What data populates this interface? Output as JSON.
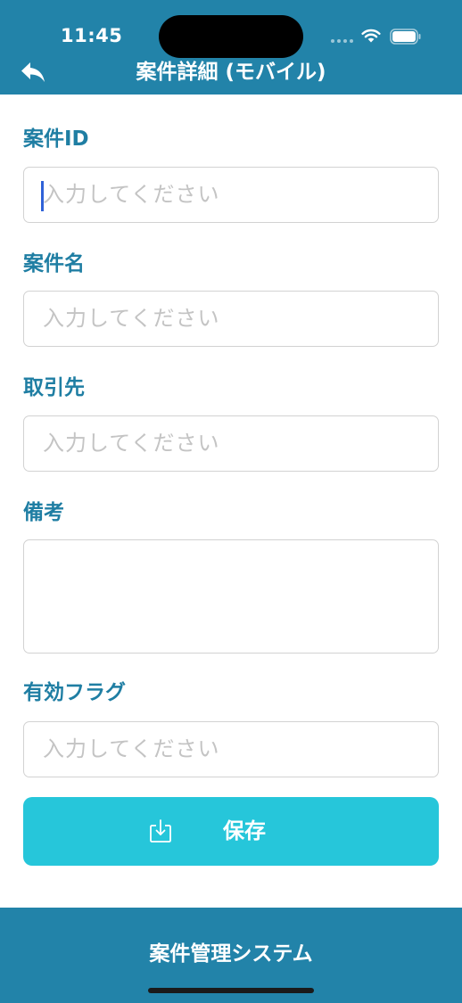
{
  "status_bar": {
    "time": "11:45"
  },
  "nav": {
    "title": "案件詳細 (モバイル)",
    "back_icon": "back-arrow-icon"
  },
  "form": {
    "fields": [
      {
        "label": "案件ID",
        "value": "",
        "placeholder": "入力してください"
      },
      {
        "label": "案件名",
        "value": "",
        "placeholder": "入力してください"
      },
      {
        "label": "取引先",
        "value": "",
        "placeholder": "入力してください"
      },
      {
        "label": "備考",
        "value": "",
        "placeholder": ""
      },
      {
        "label": "有効フラグ",
        "value": "",
        "placeholder": "入力してください"
      }
    ],
    "save_label": "保存",
    "save_icon": "download-tray-icon"
  },
  "footer": {
    "title": "案件管理システム"
  },
  "colors": {
    "header_bg": "#2283a9",
    "label": "#1f7ea3",
    "button_bg": "#26c6da",
    "caret": "#2f62d8"
  }
}
